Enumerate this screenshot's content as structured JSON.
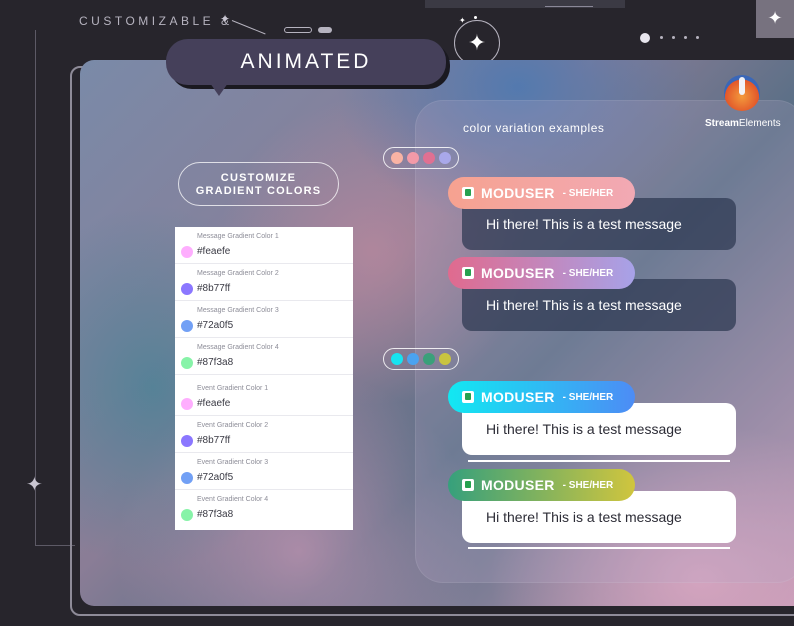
{
  "header": {
    "tagline": "CUSTOMIZABLE &",
    "banner": "ANIMATED",
    "corner_icon": "sparkle-icon"
  },
  "customize_button": {
    "line1": "CUSTOMIZE",
    "line2": "GRADIENT COLORS"
  },
  "settings": [
    {
      "label": "Message Gradient Color 1",
      "value": "#feaefe",
      "color": "#feaefe"
    },
    {
      "label": "Message Gradient Color 2",
      "value": "#8b77ff",
      "color": "#8b77ff"
    },
    {
      "label": "Message Gradient Color 3",
      "value": "#72a0f5",
      "color": "#72a0f5"
    },
    {
      "label": "Message Gradient Color 4",
      "value": "#87f3a8",
      "color": "#87f3a8"
    },
    {
      "label": "Event Gradient Color 1",
      "value": "#feaefe",
      "color": "#feaefe"
    },
    {
      "label": "Event Gradient Color 2",
      "value": "#8b77ff",
      "color": "#8b77ff"
    },
    {
      "label": "Event Gradient Color 3",
      "value": "#72a0f5",
      "color": "#72a0f5"
    },
    {
      "label": "Event Gradient Color 4",
      "value": "#87f3a8",
      "color": "#87f3a8"
    }
  ],
  "examples": {
    "caption": "color variation examples",
    "palette_a": [
      "#f9b3a4",
      "#f39aa8",
      "#e07092",
      "#a9a8ea"
    ],
    "palette_b": [
      "#17e3f0",
      "#4aa3f0",
      "#3aa07a",
      "#c9c440"
    ]
  },
  "logo": {
    "text_bold": "Stream",
    "text_rest": "Elements"
  },
  "messages": [
    {
      "name": "MODUSER",
      "pronoun": "- SHE/HER",
      "text": "Hi there! This is a test message",
      "tag_gradient": [
        "#f6a290",
        "#f2a9b4"
      ],
      "style": "dark"
    },
    {
      "name": "MODUSER",
      "pronoun": "- SHE/HER",
      "text": "Hi there! This is a test message",
      "tag_gradient": [
        "#e06a8e",
        "#a7a2e8"
      ],
      "style": "dark"
    },
    {
      "name": "MODUSER",
      "pronoun": "- SHE/HER",
      "text": "Hi there! This is a test message",
      "tag_gradient": [
        "#12e8f2",
        "#4d8cf5"
      ],
      "style": "light"
    },
    {
      "name": "MODUSER",
      "pronoun": "- SHE/HER",
      "text": "Hi there! This is a test message",
      "tag_gradient": [
        "#36a07c",
        "#d0c53e"
      ],
      "style": "light"
    }
  ]
}
